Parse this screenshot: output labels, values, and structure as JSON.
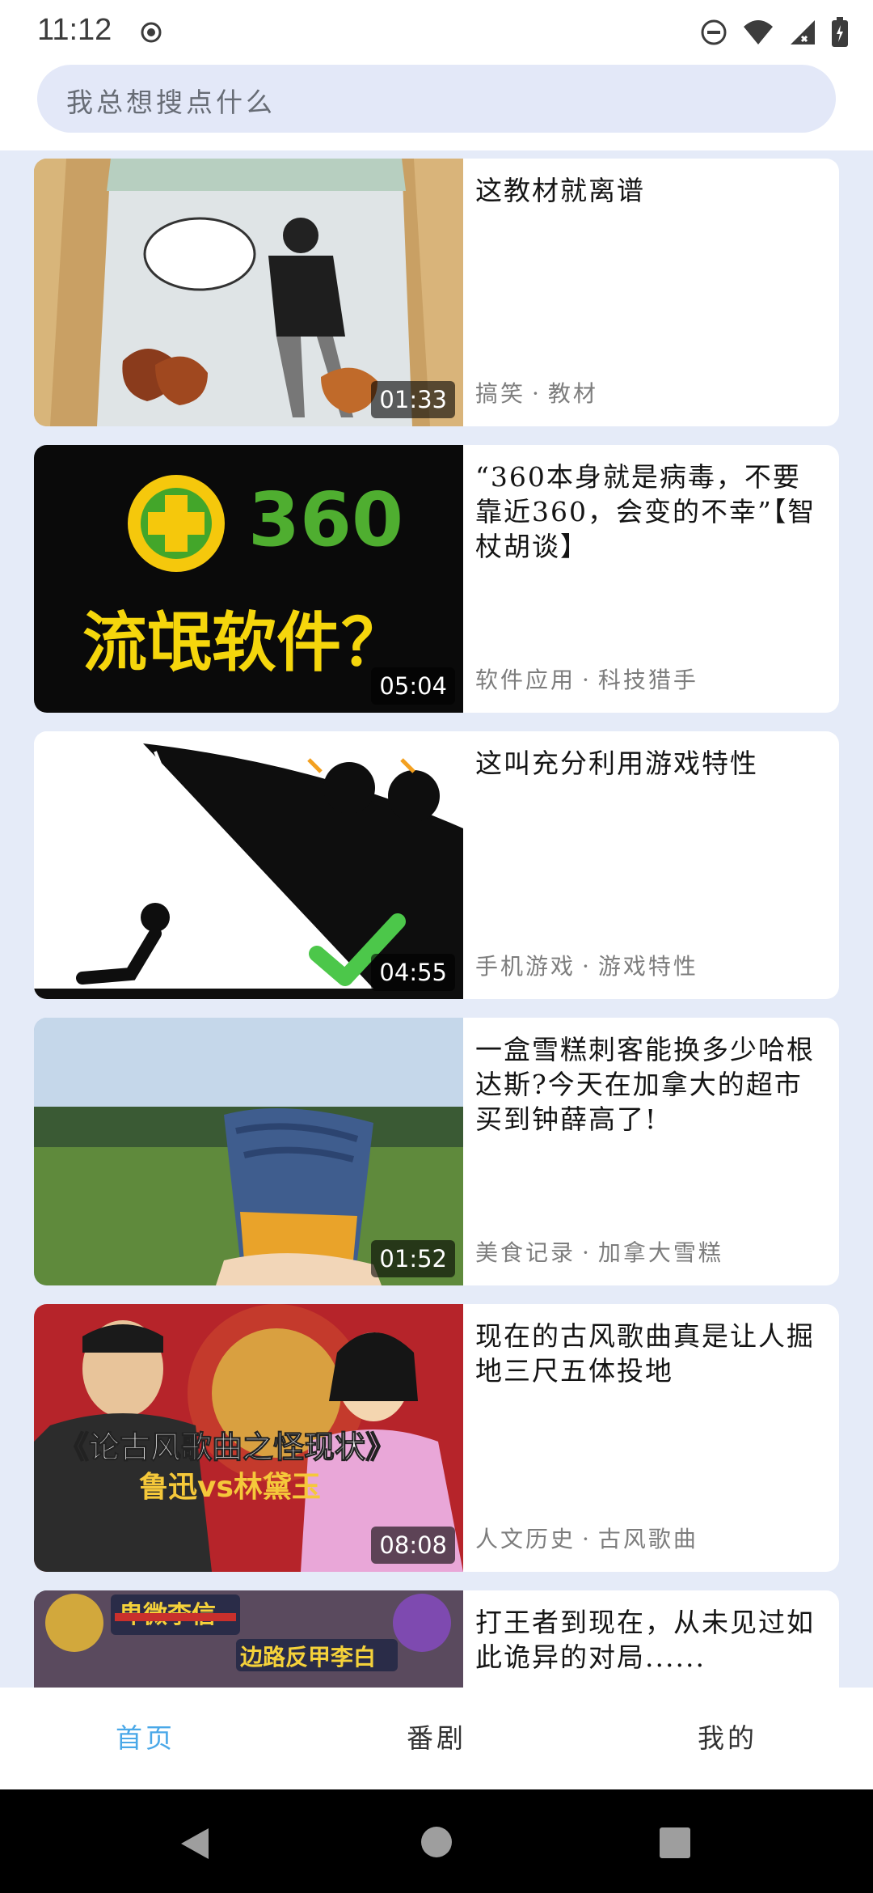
{
  "status_bar": {
    "time": "11:12",
    "icons": [
      "record-icon",
      "do-not-disturb-icon",
      "wifi-icon",
      "signal-icon",
      "battery-icon"
    ]
  },
  "search": {
    "placeholder": "我总想搜点什么"
  },
  "feed": [
    {
      "title": "这教材就离谱",
      "category": "搞笑",
      "tag": "教材",
      "duration": "01:33"
    },
    {
      "title": "“360本身就是病毒，不要靠近360，会变的不幸”【智杖胡谈】",
      "category": "软件应用",
      "tag": "科技猎手",
      "duration": "05:04",
      "thumb_text": {
        "brand": "360",
        "headline": "流氓软件？"
      }
    },
    {
      "title": "这叫充分利用游戏特性",
      "category": "手机游戏",
      "tag": "游戏特性",
      "duration": "04:55"
    },
    {
      "title": "一盒雪糕刺客能换多少哈根达斯?今天在加拿大的超市买到钟薛高了!",
      "category": "美食记录",
      "tag": "加拿大雪糕",
      "duration": "01:52"
    },
    {
      "title": "现在的古风歌曲真是让人掘地三尺五体投地",
      "category": "人文历史",
      "tag": "古风歌曲",
      "duration": "08:08",
      "thumb_text": {
        "headline": "《论古风歌曲之怪现状》",
        "sub": "鲁迅vs林黛玉"
      }
    },
    {
      "title": "打王者到现在，从未见过如此诡异的对局......",
      "category": "",
      "tag": "",
      "duration": "",
      "thumb_text": {
        "top": "卑微李信",
        "mid": "边路反甲李白"
      }
    }
  ],
  "bottom_nav": [
    {
      "label": "首页",
      "active": true
    },
    {
      "label": "番剧",
      "active": false
    },
    {
      "label": "我的",
      "active": false
    }
  ],
  "colors": {
    "active_tab": "#4aa8e8",
    "inactive_tab": "#333333",
    "search_bg": "#e3e8f8",
    "page_bg": "#e5ebf8"
  }
}
